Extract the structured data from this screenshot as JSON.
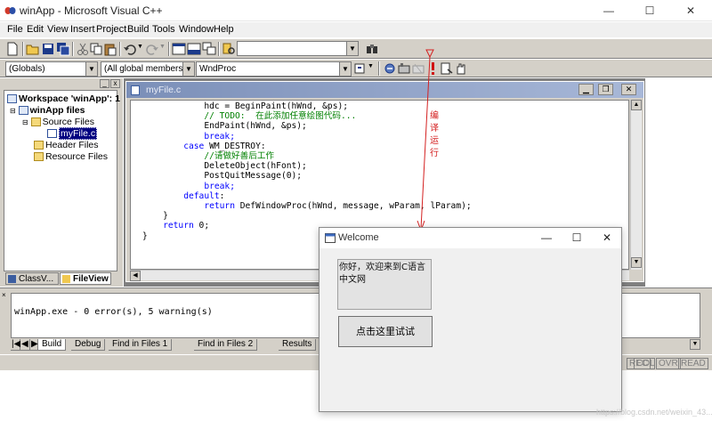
{
  "app": {
    "title": "winApp - Microsoft Visual C++",
    "caption_buttons": [
      "—",
      "☐",
      "✕"
    ]
  },
  "menu": [
    "File",
    "Edit",
    "View",
    "Insert",
    "Project",
    "Build",
    "Tools",
    "Window",
    "Help"
  ],
  "toolbar": {
    "scope_combo": "(Globals)",
    "members_combo": "(All global members",
    "function_combo": "WndProc"
  },
  "workspace": {
    "panel_buttons": [
      "_",
      "x"
    ],
    "tree": {
      "root": "Workspace 'winApp': 1",
      "project": "winApp files",
      "source_folder": "Source Files",
      "source_file": "myFile.c",
      "header_folder": "Header Files",
      "resource_folder": "Resource Files"
    },
    "tabs": [
      "ClassV...",
      "FileView"
    ]
  },
  "editor": {
    "title": "myFile.c",
    "code_lines": [
      {
        "indent": "            ",
        "tokens": [
          {
            "t": "hdc = BeginPaint(hWnd, &ps);",
            "c": "tx"
          }
        ]
      },
      {
        "indent": "            ",
        "tokens": [
          {
            "t": "// TODO:  在此添加任意绘图代码...",
            "c": "cm"
          }
        ]
      },
      {
        "indent": "            ",
        "tokens": [
          {
            "t": "EndPaint(hWnd, &ps);",
            "c": "tx"
          }
        ]
      },
      {
        "indent": "            ",
        "tokens": [
          {
            "t": "break;",
            "c": "kw"
          }
        ]
      },
      {
        "indent": "        ",
        "tokens": [
          {
            "t": "case",
            "c": "kw"
          },
          {
            "t": " WM_DESTROY:",
            "c": "tx"
          }
        ]
      },
      {
        "indent": "            ",
        "tokens": [
          {
            "t": "//请做好善后工作",
            "c": "cm"
          }
        ]
      },
      {
        "indent": "            ",
        "tokens": [
          {
            "t": "DeleteObject(hFont);",
            "c": "tx"
          }
        ]
      },
      {
        "indent": "            ",
        "tokens": [
          {
            "t": "PostQuitMessage(0);",
            "c": "tx"
          }
        ]
      },
      {
        "indent": "            ",
        "tokens": [
          {
            "t": "break;",
            "c": "kw"
          }
        ]
      },
      {
        "indent": "        ",
        "tokens": [
          {
            "t": "default",
            "c": "kw"
          },
          {
            "t": ":",
            "c": "tx"
          }
        ]
      },
      {
        "indent": "            ",
        "tokens": [
          {
            "t": "return",
            "c": "kw"
          },
          {
            "t": " DefWindowProc(hWnd, message, wParam, lParam);",
            "c": "tx"
          }
        ]
      },
      {
        "indent": "    ",
        "tokens": [
          {
            "t": "}",
            "c": "tx"
          }
        ]
      },
      {
        "indent": "    ",
        "tokens": [
          {
            "t": "return",
            "c": "kw"
          },
          {
            "t": " 0;",
            "c": "tx"
          }
        ]
      },
      {
        "indent": "",
        "tokens": [
          {
            "t": "}",
            "c": "tx"
          }
        ]
      }
    ]
  },
  "output": {
    "text": "winApp.exe - 0 error(s), 5 warning(s)",
    "tabs": [
      "Build",
      "Debug",
      "Find in Files 1",
      "Find in Files 2",
      "Results"
    ],
    "nav_buttons": [
      "|◀",
      "◀",
      "▶"
    ]
  },
  "status": [
    "REC",
    "COL",
    "OVR",
    "READ"
  ],
  "annotation": {
    "label": "编 译 运 行",
    "color": "#d42020"
  },
  "welcome": {
    "title": "Welcome",
    "caption_buttons": [
      "—",
      "☐",
      "✕"
    ],
    "static_text": "你好，欢迎来到C语言中文网",
    "button_label": "点击这里试试"
  },
  "watermark": "https://blog.csdn.net/weixin_43..."
}
